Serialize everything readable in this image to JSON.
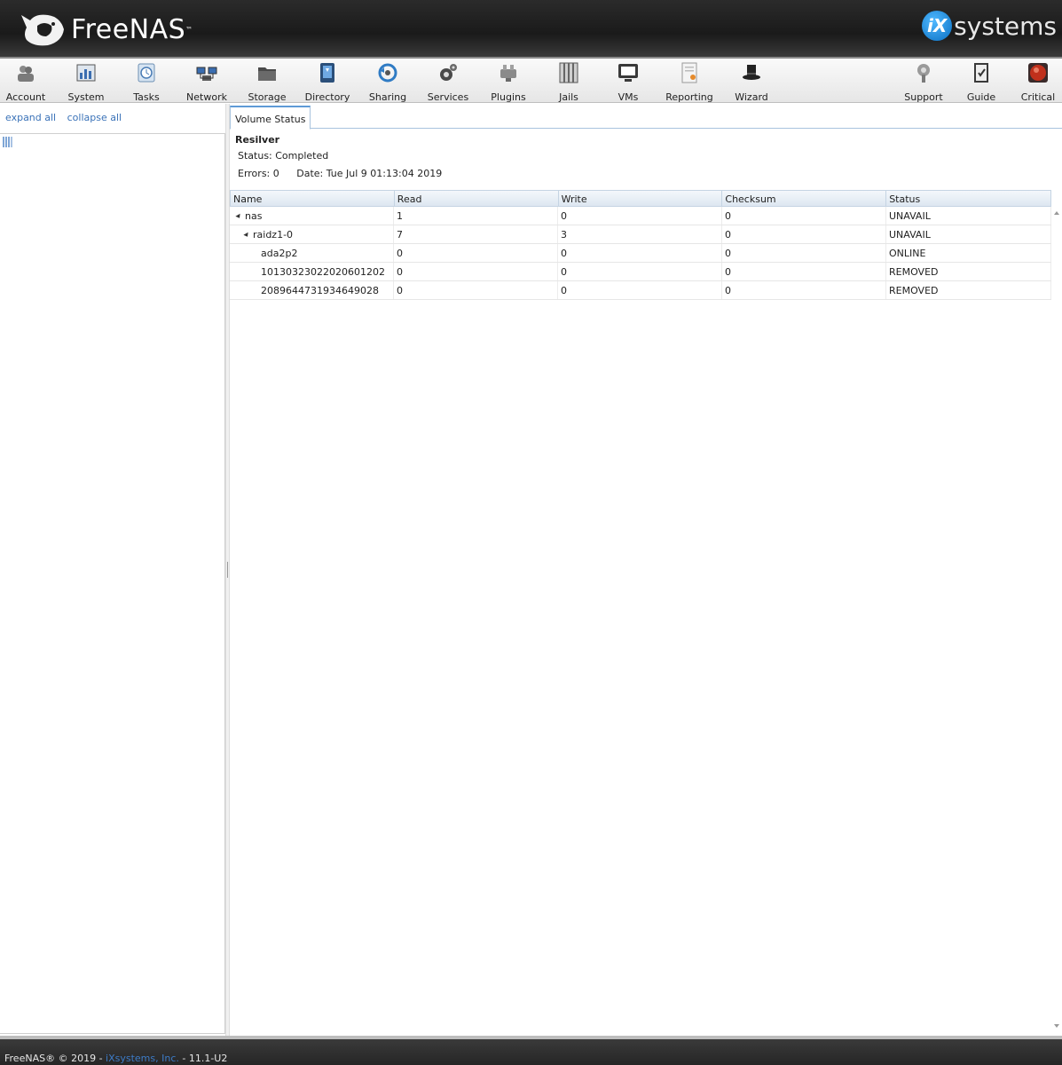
{
  "header": {
    "brand": "FreeNAS",
    "vendor_badge": "iX",
    "vendor_text": "systems"
  },
  "toolbar": {
    "items": [
      {
        "label": "Account",
        "icon": "account-icon"
      },
      {
        "label": "System",
        "icon": "system-icon"
      },
      {
        "label": "Tasks",
        "icon": "tasks-icon"
      },
      {
        "label": "Network",
        "icon": "network-icon"
      },
      {
        "label": "Storage",
        "icon": "storage-icon"
      },
      {
        "label": "Directory",
        "icon": "directory-icon"
      },
      {
        "label": "Sharing",
        "icon": "sharing-icon"
      },
      {
        "label": "Services",
        "icon": "services-icon"
      },
      {
        "label": "Plugins",
        "icon": "plugins-icon"
      },
      {
        "label": "Jails",
        "icon": "jails-icon"
      },
      {
        "label": "VMs",
        "icon": "vms-icon"
      },
      {
        "label": "Reporting",
        "icon": "reporting-icon"
      },
      {
        "label": "Wizard",
        "icon": "wizard-icon"
      },
      {
        "label": "Support",
        "icon": "support-icon"
      },
      {
        "label": "Guide",
        "icon": "guide-icon"
      },
      {
        "label": "Critical",
        "icon": "critical-icon"
      }
    ]
  },
  "sidebar": {
    "expand_all": "expand all",
    "collapse_all": "collapse all"
  },
  "tab": {
    "label": "Volume Status"
  },
  "resilver": {
    "title": "Resilver",
    "status": "Status: Completed",
    "errors": "Errors: 0",
    "date": "Date: Tue Jul 9 01:13:04 2019"
  },
  "grid": {
    "columns": [
      "Name",
      "Read",
      "Write",
      "Checksum",
      "Status"
    ],
    "rows": [
      {
        "name": "nas",
        "read": "1",
        "write": "0",
        "checksum": "0",
        "status": "UNAVAIL"
      },
      {
        "name": "raidz1-0",
        "read": "7",
        "write": "3",
        "checksum": "0",
        "status": "UNAVAIL"
      },
      {
        "name": "ada2p2",
        "read": "0",
        "write": "0",
        "checksum": "0",
        "status": "ONLINE"
      },
      {
        "name": "10130323022020601202",
        "read": "0",
        "write": "0",
        "checksum": "0",
        "status": "REMOVED"
      },
      {
        "name": "2089644731934649028",
        "read": "0",
        "write": "0",
        "checksum": "0",
        "status": "REMOVED"
      }
    ]
  },
  "footer": {
    "prefix": "FreeNAS® © 2019 - ",
    "company": "iXsystems, Inc.",
    "suffix": " - 11.1-U2"
  }
}
